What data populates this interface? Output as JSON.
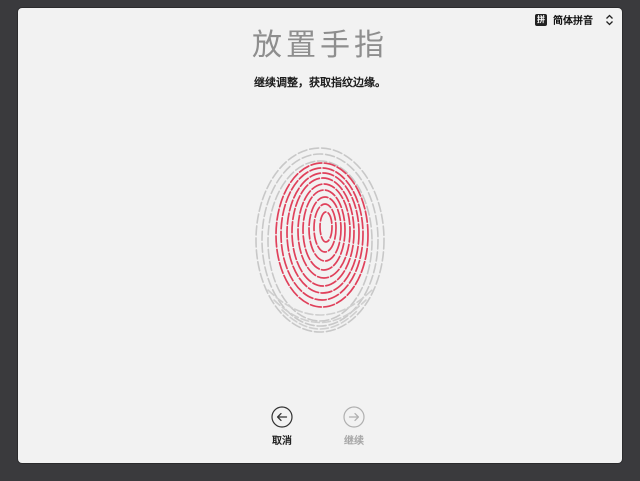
{
  "input_source": {
    "badge": "拼",
    "label": "简体拼音",
    "icon": "up-down-chevron-icon"
  },
  "setup": {
    "title": "放置手指",
    "instruction": "继续调整，获取指纹边缘。",
    "fingerprint_icon": "fingerprint-icon",
    "accent_color": "#e0415b"
  },
  "navigation": {
    "back": {
      "label": "取消",
      "icon": "back-arrow-icon"
    },
    "next": {
      "label": "继续",
      "icon": "forward-arrow-icon",
      "enabled": false
    }
  }
}
